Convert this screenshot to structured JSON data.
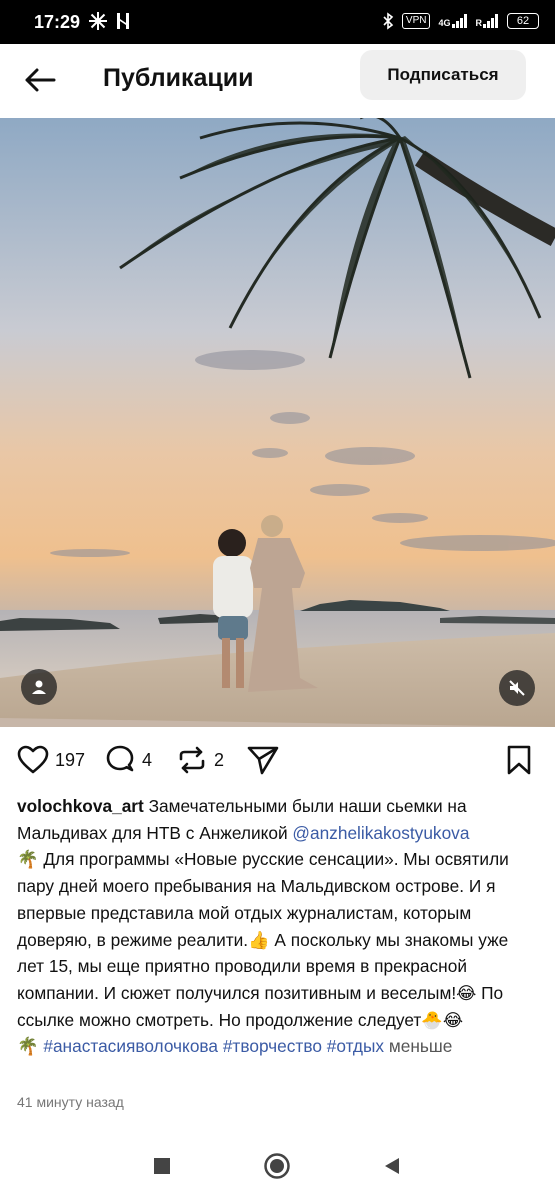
{
  "status_bar": {
    "time": "17:29",
    "vpn": "VPN",
    "net_4g": "4G",
    "net_r": "R",
    "battery": "62"
  },
  "header": {
    "title": "Публикации",
    "subscribe_label": "Подписаться"
  },
  "post": {
    "likes": "197",
    "comments": "4",
    "reposts": "2",
    "username": "volochkova_art",
    "caption_1": " Замечательными были наши сьемки на Мальдивах для НТВ с Анжеликой ",
    "mention": "@anzhelikakostyukova",
    "caption_2": "🌴 Для программы «Новые русские сенсации». Мы освятили пару дней моего пребывания на Мальдивском острове. И я впервые представила мой отдых журналистам, которым доверяю, в режиме реалити.👍 А поскольку мы знакомы уже лет 15, мы еще приятно проводили время в прекрасной компании. И сюжет получился позитивным и веселым!😂 По ссылке можно смотреть. Но продолжение следует🐣😂",
    "caption_3": "🌴 ",
    "hashtags": "#анастасияволочкова #творчество #отдых",
    "more": " меньше",
    "time_ago": "41 минуту назад"
  },
  "colors": {
    "link": "#3b5ba5",
    "status_bar_bg": "#000000",
    "subscribe_bg": "#efefef"
  }
}
